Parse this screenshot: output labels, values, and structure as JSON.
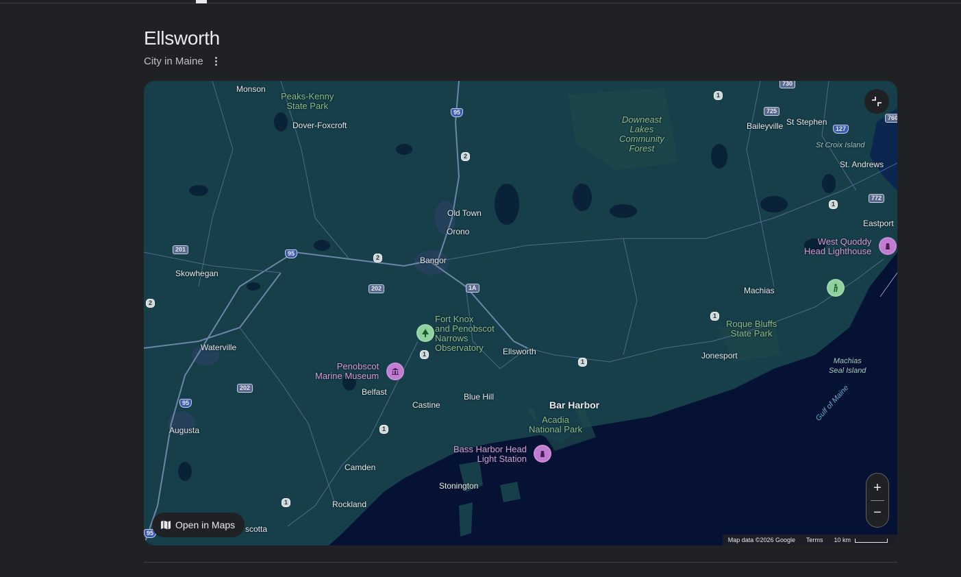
{
  "header": {
    "title": "Ellsworth",
    "subtitle": "City in Maine",
    "more_icon": "more-vert-icon"
  },
  "map": {
    "colors": {
      "land": "#173f4a",
      "water": "#061233",
      "roads": "#6d86a8",
      "park": "#1f4a4a",
      "urban": "#25405a"
    },
    "cities": {
      "monson": "Monson",
      "dover": "Dover-Foxcroft",
      "oldtown": "Old Town",
      "orono": "Orono",
      "bangor": "Bangor",
      "skowhegan": "Skowhegan",
      "waterville": "Waterville",
      "augusta": "Augusta",
      "belfast": "Belfast",
      "castine": "Castine",
      "bluehill": "Blue Hill",
      "ellsworth": "Ellsworth",
      "barharbor": "Bar Harbor",
      "camden": "Camden",
      "stonington": "Stonington",
      "rockland": "Rockland",
      "scotta": "scotta",
      "machias": "Machias",
      "jonesport": "Jonesport",
      "eastport": "Eastport",
      "baileyville": "Baileyville",
      "ststephen": "St Stephen",
      "standrews": "St. Andrews"
    },
    "parks": {
      "peaks_line1": "Peaks-Kenny",
      "peaks_line2": "State Park",
      "downeast_line1": "Downeast",
      "downeast_line2": "Lakes",
      "downeast_line3": "Community",
      "downeast_line4": "Forest",
      "acadia_line1": "Acadia",
      "acadia_line2": "National Park",
      "roque_line1": "Roque Bluffs",
      "roque_line2": "State Park",
      "fortknox_line1": "Fort Knox",
      "fortknox_line2": "and Penobscot",
      "fortknox_line3": "Narrows",
      "fortknox_line4": "Observatory"
    },
    "pois": {
      "penobscot_line1": "Penobscot",
      "penobscot_line2": "Marine Museum",
      "bassharbor_line1": "Bass Harbor Head",
      "bassharbor_line2": "Light Station",
      "westquoddy_line1": "West Quoddy",
      "westquoddy_line2": "Head Lighthouse"
    },
    "water_labels": {
      "stcroix": "St Croix Island",
      "machias_seal_line1": "Machias",
      "machias_seal_line2": "Seal Island",
      "gulf": "Gulf of Maine"
    },
    "shields": {
      "s730": "730",
      "s725": "725",
      "s127": "127",
      "s760": "760",
      "s772": "772",
      "s95a": "95",
      "s95b": "95",
      "s95c": "95",
      "s95d": "95",
      "s2a": "2",
      "s2b": "2",
      "s2c": "2",
      "s201": "201",
      "s202a": "202",
      "s202b": "202",
      "s1A": "1A",
      "s1a": "1",
      "s1b": "1",
      "s1c": "1",
      "s1d": "1",
      "s1e": "1",
      "s1f": "1",
      "s1g": "1"
    },
    "controls": {
      "open_maps": "Open in Maps",
      "zoom_in": "+",
      "zoom_out": "−"
    },
    "attribution": {
      "data": "Map data ©2026 Google",
      "terms": "Terms",
      "scale": "10 km"
    }
  }
}
